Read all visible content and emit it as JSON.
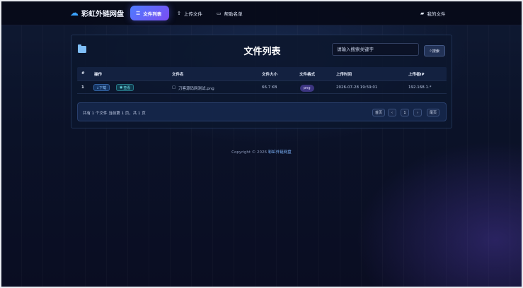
{
  "brand": {
    "name": "彩虹外链网盘",
    "icon": "cloud-icon"
  },
  "nav": {
    "items": [
      {
        "label": "文件列表",
        "icon": "list-icon",
        "active": true
      },
      {
        "label": "上传文件",
        "icon": "upload-icon",
        "active": false
      },
      {
        "label": "帮助名单",
        "icon": "id-card-icon",
        "active": false
      }
    ],
    "right": {
      "label": "我的文件",
      "icon": "folder-icon"
    }
  },
  "card": {
    "title": "文件列表",
    "search": {
      "placeholder": "请输入搜索关键字",
      "button_label": "搜索",
      "button_icon": "search-icon"
    }
  },
  "table": {
    "headers": [
      "#",
      "操作",
      "文件名",
      "文件大小",
      "文件格式",
      "上传时间",
      "上传者IP"
    ],
    "rows": [
      {
        "index": "1",
        "download_label": "下载",
        "view_label": "查看",
        "filename": "刀客源码网测试.png",
        "size": "66.7 KB",
        "format": "png",
        "time": "2026-07-28 19:59:01",
        "ip": "192.168.1.*"
      }
    ]
  },
  "pagination": {
    "info": "共有 1 个文件  当前第 1 页，共 1 页",
    "first": "首页",
    "prev": "‹",
    "current": "1",
    "next": "›",
    "last": "尾页"
  },
  "footer": {
    "copyright": "Copyright © 2026",
    "brand": "彩虹外链网盘"
  },
  "colors": {
    "accent_start": "#4e7bff",
    "accent_end": "#7a4df2",
    "link": "#7fb6ff"
  }
}
